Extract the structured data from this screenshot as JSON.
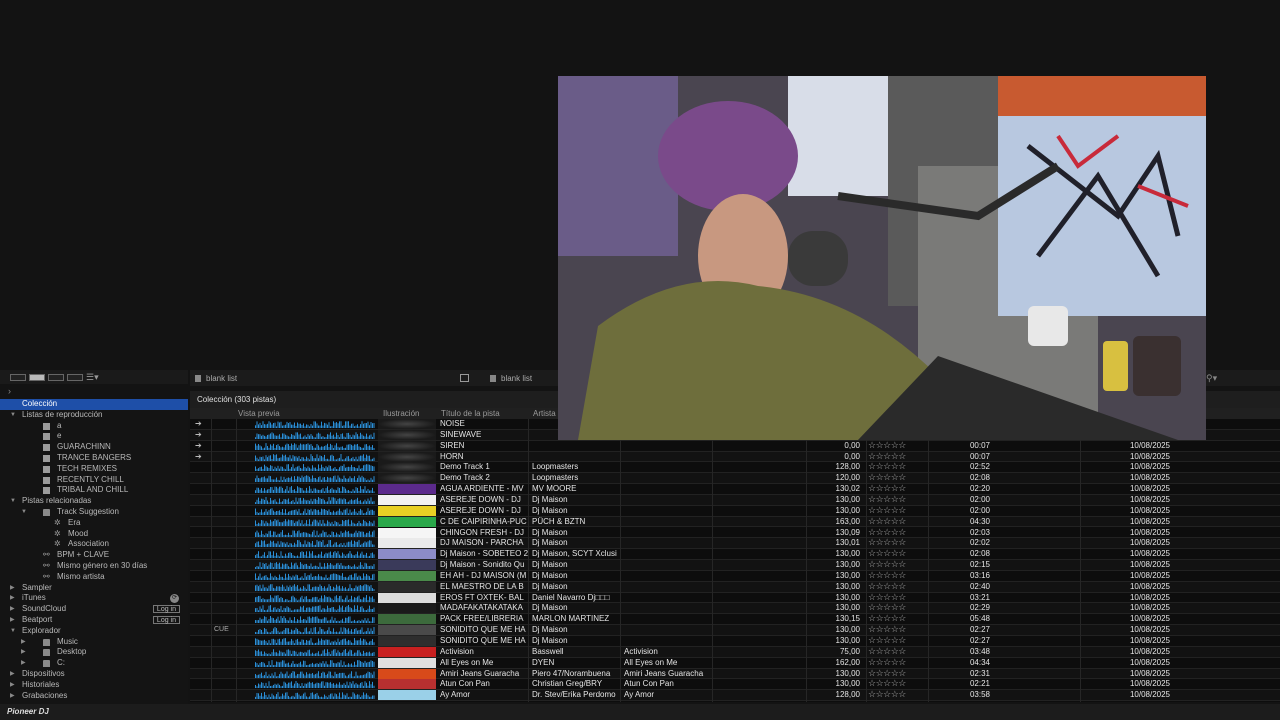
{
  "brand": {
    "name": "Pioneer DJ"
  },
  "tabs": [
    {
      "label": "blank list"
    },
    {
      "label": "blank list"
    }
  ],
  "collection": {
    "title": "Colección (303 pistas)"
  },
  "columns": {
    "preview": "Vista previa",
    "artwork": "Ilustración",
    "title": "Título de la pista",
    "artist": "Artista"
  },
  "tree": [
    {
      "label": "Colección",
      "level": 0,
      "arrow": "",
      "glyph": "",
      "selected": true
    },
    {
      "label": "Listas de reproducción",
      "level": 0,
      "arrow": "▼",
      "glyph": ""
    },
    {
      "label": "a",
      "level": 1,
      "arrow": "",
      "glyph": "list"
    },
    {
      "label": "e",
      "level": 1,
      "arrow": "",
      "glyph": "list"
    },
    {
      "label": "GUARACHINN",
      "level": 1,
      "arrow": "",
      "glyph": "list"
    },
    {
      "label": "TRANCE BANGERS",
      "level": 1,
      "arrow": "",
      "glyph": "list"
    },
    {
      "label": "TECH REMIXES",
      "level": 1,
      "arrow": "",
      "glyph": "list"
    },
    {
      "label": "RECENTLY CHILL",
      "level": 1,
      "arrow": "",
      "glyph": "list"
    },
    {
      "label": "TRIBAL AND CHILL",
      "level": 1,
      "arrow": "",
      "glyph": "list"
    },
    {
      "label": "Pistas relacionadas",
      "level": 0,
      "arrow": "▼",
      "glyph": ""
    },
    {
      "label": "Track Suggestion",
      "level": 1,
      "arrow": "▼",
      "glyph": "folder"
    },
    {
      "label": "Era",
      "level": 2,
      "arrow": "",
      "glyph": "gear"
    },
    {
      "label": "Mood",
      "level": 2,
      "arrow": "",
      "glyph": "gear"
    },
    {
      "label": "Association",
      "level": 2,
      "arrow": "",
      "glyph": "gear"
    },
    {
      "label": "BPM + CLAVE",
      "level": 1,
      "arrow": "",
      "glyph": "link"
    },
    {
      "label": "Mismo género en 30 días",
      "level": 1,
      "arrow": "",
      "glyph": "link"
    },
    {
      "label": "Mismo artista",
      "level": 1,
      "arrow": "",
      "glyph": "link"
    },
    {
      "label": "Sampler",
      "level": 0,
      "arrow": "▶",
      "glyph": ""
    },
    {
      "label": "iTunes",
      "level": 0,
      "arrow": "▶",
      "glyph": "",
      "badge": "⟳"
    },
    {
      "label": "SoundCloud",
      "level": 0,
      "arrow": "▶",
      "glyph": "",
      "login": "Log in"
    },
    {
      "label": "Beatport",
      "level": 0,
      "arrow": "▶",
      "glyph": "",
      "login": "Log in"
    },
    {
      "label": "Explorador",
      "level": 0,
      "arrow": "▼",
      "glyph": ""
    },
    {
      "label": "Music",
      "level": 1,
      "arrow": "▶",
      "glyph": "folder"
    },
    {
      "label": "Desktop",
      "level": 1,
      "arrow": "▶",
      "glyph": "folder"
    },
    {
      "label": "C:",
      "level": 1,
      "arrow": "▶",
      "glyph": "folder"
    },
    {
      "label": "Dispositivos",
      "level": 0,
      "arrow": "▶",
      "glyph": ""
    },
    {
      "label": "Historiales",
      "level": 0,
      "arrow": "▶",
      "glyph": ""
    },
    {
      "label": "Grabaciones",
      "level": 0,
      "arrow": "▶",
      "glyph": ""
    }
  ],
  "tracks": [
    {
      "mark": "➔",
      "cue": "",
      "title": "NOISE",
      "artist": "",
      "album": "",
      "bpm": "",
      "time": "",
      "date": "",
      "art": ""
    },
    {
      "mark": "➔",
      "cue": "",
      "title": "SINEWAVE",
      "artist": "",
      "album": "",
      "bpm": "",
      "time": "",
      "date": "",
      "art": ""
    },
    {
      "mark": "➔",
      "cue": "",
      "title": "SIREN",
      "artist": "",
      "album": "",
      "bpm": "0,00",
      "time": "00:07",
      "date": "10/08/2025",
      "art": ""
    },
    {
      "mark": "➔",
      "cue": "",
      "title": "HORN",
      "artist": "",
      "album": "",
      "bpm": "0,00",
      "time": "00:07",
      "date": "10/08/2025",
      "art": ""
    },
    {
      "mark": "",
      "cue": "",
      "title": "Demo Track 1",
      "artist": "Loopmasters",
      "album": "",
      "bpm": "128,00",
      "time": "02:52",
      "date": "10/08/2025",
      "art": ""
    },
    {
      "mark": "",
      "cue": "",
      "title": "Demo Track 2",
      "artist": "Loopmasters",
      "album": "",
      "bpm": "120,00",
      "time": "02:08",
      "date": "10/08/2025",
      "art": ""
    },
    {
      "mark": "",
      "cue": "",
      "title": "AGUA ARDIENTE - MV",
      "artist": "MV MOORE",
      "album": "",
      "bpm": "130,02",
      "time": "02:20",
      "date": "10/08/2025",
      "art": "#5b2a8c"
    },
    {
      "mark": "",
      "cue": "",
      "title": "ASEREJE DOWN - DJ",
      "artist": "Dj Maison",
      "album": "",
      "bpm": "130,00",
      "time": "02:00",
      "date": "10/08/2025",
      "art": "#f2f2f2"
    },
    {
      "mark": "",
      "cue": "",
      "title": "ASEREJE DOWN - DJ",
      "artist": "Dj Maison",
      "album": "",
      "bpm": "130,00",
      "time": "02:00",
      "date": "10/08/2025",
      "art": "#e8d024"
    },
    {
      "mark": "",
      "cue": "",
      "title": "C DE CAIPIRINHA-PUC",
      "artist": "PÜCH & BZTN",
      "album": "",
      "bpm": "163,00",
      "time": "04:30",
      "date": "10/08/2025",
      "art": "#2aa84a"
    },
    {
      "mark": "",
      "cue": "",
      "title": "CHINGON FRESH - DJ",
      "artist": "Dj Maison",
      "album": "",
      "bpm": "130,09",
      "time": "02:03",
      "date": "10/08/2025",
      "art": "#f5f5f5"
    },
    {
      "mark": "",
      "cue": "",
      "title": "DJ MAISON - PARCHA",
      "artist": "Dj Maison",
      "album": "",
      "bpm": "130,01",
      "time": "02:02",
      "date": "10/08/2025",
      "art": "#eaeaea"
    },
    {
      "mark": "",
      "cue": "",
      "title": "Dj Maison - SOBETEO 2",
      "artist": "Dj Maison, SCYT Xclusi",
      "album": "",
      "bpm": "130,00",
      "time": "02:08",
      "date": "10/08/2025",
      "art": "#8c8cc8"
    },
    {
      "mark": "",
      "cue": "",
      "title": "Dj Maison - Sonidito Qu",
      "artist": "Dj Maison",
      "album": "",
      "bpm": "130,00",
      "time": "02:15",
      "date": "10/08/2025",
      "art": "#3a3a5a"
    },
    {
      "mark": "",
      "cue": "",
      "title": "EH AH - DJ MAISON (M",
      "artist": "Dj Maison",
      "album": "",
      "bpm": "130,00",
      "time": "03:16",
      "date": "10/08/2025",
      "art": "#4a8a4a"
    },
    {
      "mark": "",
      "cue": "",
      "title": "EL MAESTRO DE LA B",
      "artist": "Dj Maison",
      "album": "",
      "bpm": "130,00",
      "time": "02:40",
      "date": "10/08/2025",
      "art": "#2a2a2a"
    },
    {
      "mark": "",
      "cue": "",
      "title": "EROS FT OXTEK- BAL",
      "artist": "Daniel Navarro Dj□□□",
      "album": "",
      "bpm": "130,00",
      "time": "03:21",
      "date": "10/08/2025",
      "art": "#dcdcdc"
    },
    {
      "mark": "",
      "cue": "",
      "title": "MADAFAKATAKATAKA",
      "artist": "Dj Maison",
      "album": "",
      "bpm": "130,00",
      "time": "02:29",
      "date": "10/08/2025",
      "art": "#1a1a1a"
    },
    {
      "mark": "",
      "cue": "",
      "title": "PACK FREE/LIBRERIA",
      "artist": "MARLON MARTINEZ",
      "album": "",
      "bpm": "130,15",
      "time": "05:48",
      "date": "10/08/2025",
      "art": "#3c6a3c"
    },
    {
      "mark": "",
      "cue": "CUE",
      "title": "SONIDITO QUE ME HA",
      "artist": "Dj Maison",
      "album": "",
      "bpm": "130,00",
      "time": "02:27",
      "date": "10/08/2025",
      "art": "#4a4a4a"
    },
    {
      "mark": "",
      "cue": "",
      "title": "SONIDITO QUE ME HA",
      "artist": "Dj Maison",
      "album": "",
      "bpm": "130,00",
      "time": "02:27",
      "date": "10/08/2025",
      "art": "#2e2e2e"
    },
    {
      "mark": "",
      "cue": "",
      "title": "Activision",
      "artist": "Basswell",
      "album": "Activision",
      "bpm": "75,00",
      "time": "03:48",
      "date": "10/08/2025",
      "art": "#c82020"
    },
    {
      "mark": "",
      "cue": "",
      "title": "All Eyes on Me",
      "artist": "DYEN",
      "album": "All Eyes on Me",
      "bpm": "162,00",
      "time": "04:34",
      "date": "10/08/2025",
      "art": "#e0e0e0"
    },
    {
      "mark": "",
      "cue": "",
      "title": "Amiri Jeans Guaracha",
      "artist": "Piero 47/Norambuena",
      "album": "Amiri Jeans Guaracha",
      "bpm": "130,00",
      "time": "02:31",
      "date": "10/08/2025",
      "art": "#d84a1a"
    },
    {
      "mark": "",
      "cue": "",
      "title": "Atun Con Pan",
      "artist": "Christian Greg/BRY",
      "album": "Atun Con Pan",
      "bpm": "130,00",
      "time": "02:21",
      "date": "10/08/2025",
      "art": "#b83030"
    },
    {
      "mark": "",
      "cue": "",
      "title": "Ay Amor",
      "artist": "Dr. Stev/Erika Perdomo",
      "album": "Ay Amor",
      "bpm": "128,00",
      "time": "03:58",
      "date": "10/08/2025",
      "art": "#9ad0e8"
    }
  ],
  "rating_empty": "☆☆☆☆☆",
  "colors": {
    "accent": "#1e4fa8",
    "wave": "#2a8fd8"
  }
}
